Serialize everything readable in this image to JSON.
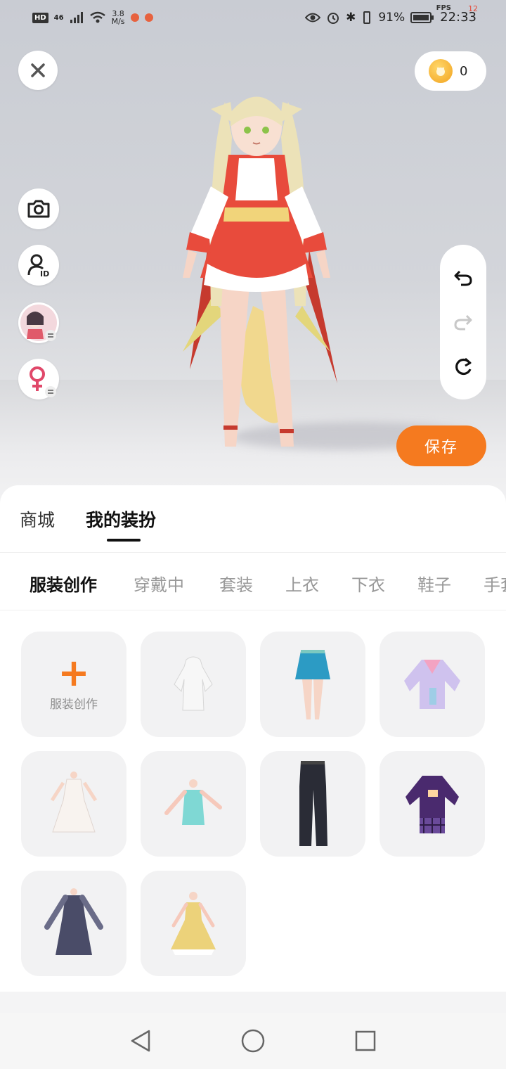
{
  "status_bar": {
    "hd": "HD",
    "net_type": "46",
    "speed_value": "3.8",
    "speed_unit": "M/s",
    "battery": "91%",
    "time": "22:33",
    "fps_label": "FPS",
    "fps_value": "12"
  },
  "top": {
    "coins": "0"
  },
  "actions": {
    "save_label": "保存"
  },
  "tabs": [
    {
      "label": "商城",
      "active": false
    },
    {
      "label": "我的装扮",
      "active": true
    }
  ],
  "subtabs": [
    {
      "label": "服装创作",
      "active": true
    },
    {
      "label": "穿戴中",
      "active": false
    },
    {
      "label": "套装",
      "active": false
    },
    {
      "label": "上衣",
      "active": false
    },
    {
      "label": "下衣",
      "active": false
    },
    {
      "label": "鞋子",
      "active": false
    },
    {
      "label": "手套",
      "active": false
    }
  ],
  "grid": {
    "create_label": "服装创作",
    "items": [
      {
        "icon": "white-hoodie-dress-icon"
      },
      {
        "icon": "blue-pleated-skirt-icon"
      },
      {
        "icon": "lavender-sailor-top-icon"
      },
      {
        "icon": "white-frilly-dress-icon"
      },
      {
        "icon": "teal-corset-top-icon"
      },
      {
        "icon": "black-flared-pants-icon"
      },
      {
        "icon": "purple-plaid-outfit-icon"
      },
      {
        "icon": "navy-long-dress-icon"
      },
      {
        "icon": "yellow-ball-gown-icon"
      }
    ]
  },
  "colors": {
    "accent": "#f57a1f",
    "sheet_bg": "#ffffff",
    "tile_bg": "#f2f2f3"
  }
}
